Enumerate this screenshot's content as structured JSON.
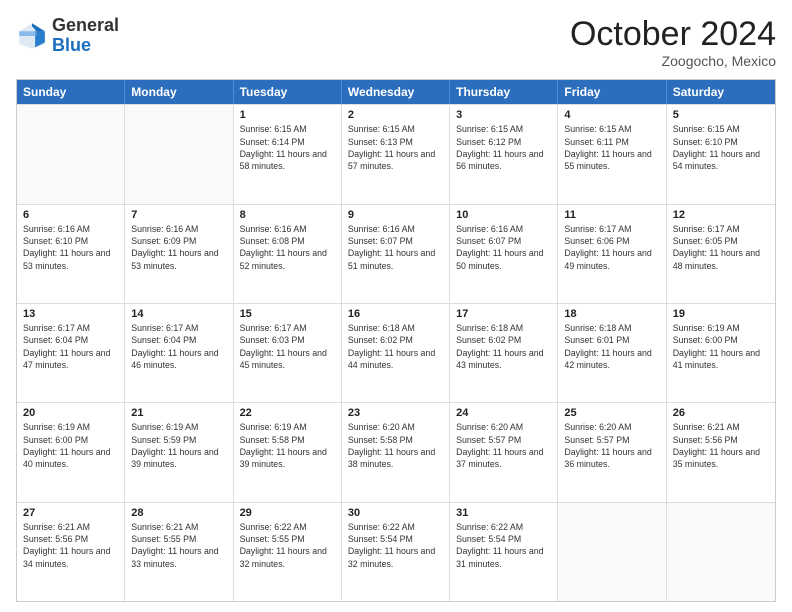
{
  "header": {
    "logo_general": "General",
    "logo_blue": "Blue",
    "month_title": "October 2024",
    "location": "Zoogocho, Mexico"
  },
  "weekdays": [
    "Sunday",
    "Monday",
    "Tuesday",
    "Wednesday",
    "Thursday",
    "Friday",
    "Saturday"
  ],
  "rows": [
    [
      {
        "day": "",
        "info": ""
      },
      {
        "day": "",
        "info": ""
      },
      {
        "day": "1",
        "info": "Sunrise: 6:15 AM\nSunset: 6:14 PM\nDaylight: 11 hours and 58 minutes."
      },
      {
        "day": "2",
        "info": "Sunrise: 6:15 AM\nSunset: 6:13 PM\nDaylight: 11 hours and 57 minutes."
      },
      {
        "day": "3",
        "info": "Sunrise: 6:15 AM\nSunset: 6:12 PM\nDaylight: 11 hours and 56 minutes."
      },
      {
        "day": "4",
        "info": "Sunrise: 6:15 AM\nSunset: 6:11 PM\nDaylight: 11 hours and 55 minutes."
      },
      {
        "day": "5",
        "info": "Sunrise: 6:15 AM\nSunset: 6:10 PM\nDaylight: 11 hours and 54 minutes."
      }
    ],
    [
      {
        "day": "6",
        "info": "Sunrise: 6:16 AM\nSunset: 6:10 PM\nDaylight: 11 hours and 53 minutes."
      },
      {
        "day": "7",
        "info": "Sunrise: 6:16 AM\nSunset: 6:09 PM\nDaylight: 11 hours and 53 minutes."
      },
      {
        "day": "8",
        "info": "Sunrise: 6:16 AM\nSunset: 6:08 PM\nDaylight: 11 hours and 52 minutes."
      },
      {
        "day": "9",
        "info": "Sunrise: 6:16 AM\nSunset: 6:07 PM\nDaylight: 11 hours and 51 minutes."
      },
      {
        "day": "10",
        "info": "Sunrise: 6:16 AM\nSunset: 6:07 PM\nDaylight: 11 hours and 50 minutes."
      },
      {
        "day": "11",
        "info": "Sunrise: 6:17 AM\nSunset: 6:06 PM\nDaylight: 11 hours and 49 minutes."
      },
      {
        "day": "12",
        "info": "Sunrise: 6:17 AM\nSunset: 6:05 PM\nDaylight: 11 hours and 48 minutes."
      }
    ],
    [
      {
        "day": "13",
        "info": "Sunrise: 6:17 AM\nSunset: 6:04 PM\nDaylight: 11 hours and 47 minutes."
      },
      {
        "day": "14",
        "info": "Sunrise: 6:17 AM\nSunset: 6:04 PM\nDaylight: 11 hours and 46 minutes."
      },
      {
        "day": "15",
        "info": "Sunrise: 6:17 AM\nSunset: 6:03 PM\nDaylight: 11 hours and 45 minutes."
      },
      {
        "day": "16",
        "info": "Sunrise: 6:18 AM\nSunset: 6:02 PM\nDaylight: 11 hours and 44 minutes."
      },
      {
        "day": "17",
        "info": "Sunrise: 6:18 AM\nSunset: 6:02 PM\nDaylight: 11 hours and 43 minutes."
      },
      {
        "day": "18",
        "info": "Sunrise: 6:18 AM\nSunset: 6:01 PM\nDaylight: 11 hours and 42 minutes."
      },
      {
        "day": "19",
        "info": "Sunrise: 6:19 AM\nSunset: 6:00 PM\nDaylight: 11 hours and 41 minutes."
      }
    ],
    [
      {
        "day": "20",
        "info": "Sunrise: 6:19 AM\nSunset: 6:00 PM\nDaylight: 11 hours and 40 minutes."
      },
      {
        "day": "21",
        "info": "Sunrise: 6:19 AM\nSunset: 5:59 PM\nDaylight: 11 hours and 39 minutes."
      },
      {
        "day": "22",
        "info": "Sunrise: 6:19 AM\nSunset: 5:58 PM\nDaylight: 11 hours and 39 minutes."
      },
      {
        "day": "23",
        "info": "Sunrise: 6:20 AM\nSunset: 5:58 PM\nDaylight: 11 hours and 38 minutes."
      },
      {
        "day": "24",
        "info": "Sunrise: 6:20 AM\nSunset: 5:57 PM\nDaylight: 11 hours and 37 minutes."
      },
      {
        "day": "25",
        "info": "Sunrise: 6:20 AM\nSunset: 5:57 PM\nDaylight: 11 hours and 36 minutes."
      },
      {
        "day": "26",
        "info": "Sunrise: 6:21 AM\nSunset: 5:56 PM\nDaylight: 11 hours and 35 minutes."
      }
    ],
    [
      {
        "day": "27",
        "info": "Sunrise: 6:21 AM\nSunset: 5:56 PM\nDaylight: 11 hours and 34 minutes."
      },
      {
        "day": "28",
        "info": "Sunrise: 6:21 AM\nSunset: 5:55 PM\nDaylight: 11 hours and 33 minutes."
      },
      {
        "day": "29",
        "info": "Sunrise: 6:22 AM\nSunset: 5:55 PM\nDaylight: 11 hours and 32 minutes."
      },
      {
        "day": "30",
        "info": "Sunrise: 6:22 AM\nSunset: 5:54 PM\nDaylight: 11 hours and 32 minutes."
      },
      {
        "day": "31",
        "info": "Sunrise: 6:22 AM\nSunset: 5:54 PM\nDaylight: 11 hours and 31 minutes."
      },
      {
        "day": "",
        "info": ""
      },
      {
        "day": "",
        "info": ""
      }
    ]
  ]
}
